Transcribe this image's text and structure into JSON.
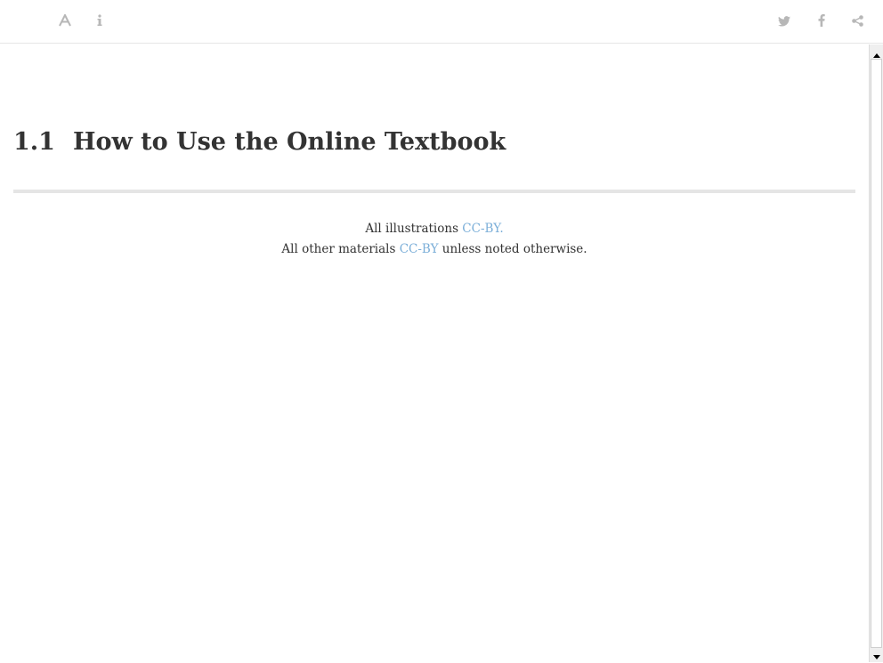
{
  "toolbar": {
    "left_icons": [
      "font-settings-icon",
      "info-icon"
    ],
    "right_icons": [
      "twitter-icon",
      "facebook-icon",
      "share-icon"
    ],
    "icon_color": "#b7b7b7"
  },
  "main": {
    "section_number": "1.1",
    "title": "How to Use the Online Textbook",
    "license": {
      "line1_prefix": "All illustrations ",
      "line1_link": "CC-BY.",
      "line2_prefix": "All other materials ",
      "line2_link": "CC-BY",
      "line2_suffix": " unless noted otherwise."
    },
    "link_color": "#7aaed8"
  }
}
